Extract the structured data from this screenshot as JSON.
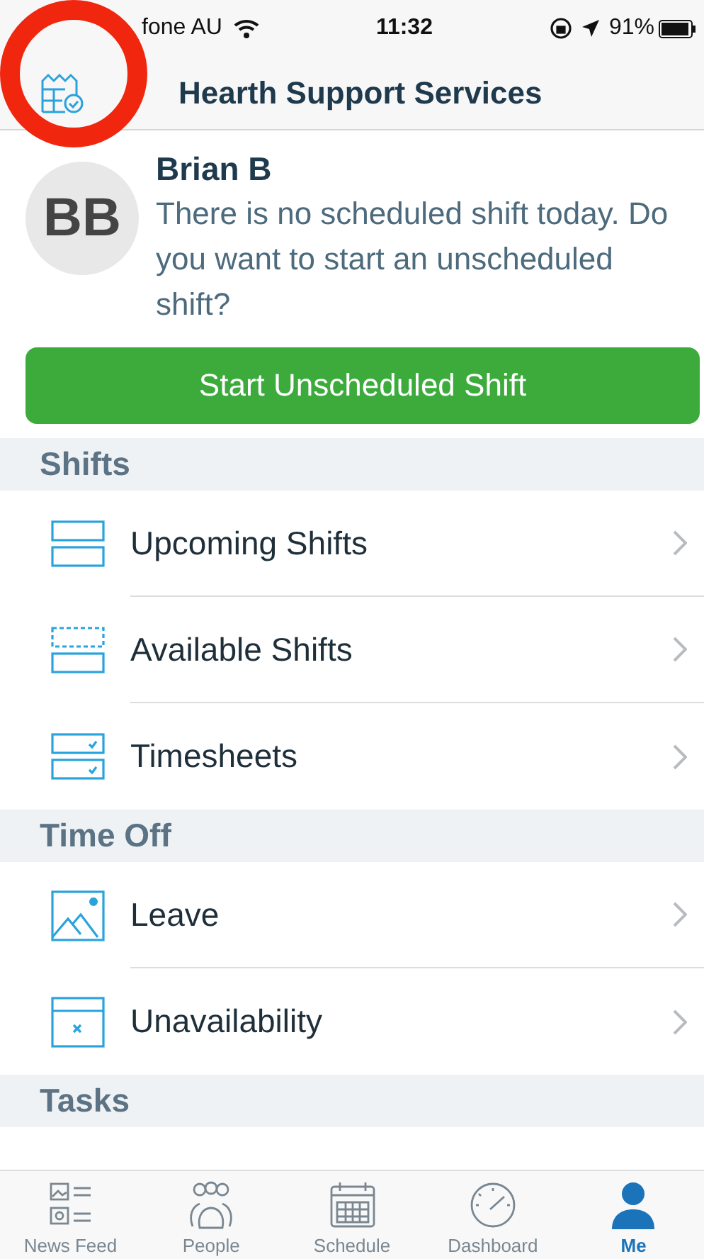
{
  "status_bar": {
    "carrier": "fone AU",
    "time": "11:32",
    "battery": "91%"
  },
  "header": {
    "title": "Hearth Support Services"
  },
  "profile": {
    "initials": "BB",
    "name": "Brian B",
    "message": "There is no scheduled shift today. Do you want to start an unscheduled shift?"
  },
  "start_button": "Start Unscheduled Shift",
  "sections": [
    {
      "title": "Shifts",
      "items": [
        {
          "kind": "upcoming",
          "label": "Upcoming Shifts"
        },
        {
          "kind": "available",
          "label": "Available Shifts"
        },
        {
          "kind": "timesheet",
          "label": "Timesheets"
        }
      ]
    },
    {
      "title": "Time Off",
      "items": [
        {
          "kind": "leave",
          "label": "Leave"
        },
        {
          "kind": "unavailability",
          "label": "Unavailability"
        }
      ]
    },
    {
      "title": "Tasks"
    }
  ],
  "tab_bar": [
    {
      "kind": "news",
      "label": "News Feed",
      "selected": false
    },
    {
      "kind": "people",
      "label": "People",
      "selected": false
    },
    {
      "kind": "schedule",
      "label": "Schedule",
      "selected": false
    },
    {
      "kind": "dashboard",
      "label": "Dashboard",
      "selected": false
    },
    {
      "kind": "me",
      "label": "Me",
      "selected": true
    }
  ]
}
